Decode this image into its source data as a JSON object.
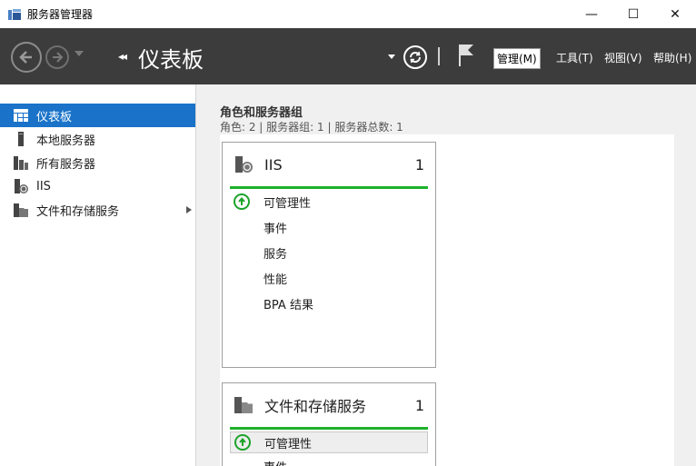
{
  "window": {
    "title": "服务器管理器",
    "controls": {
      "minimize": "—",
      "maximize": "☐",
      "close": "✕"
    }
  },
  "header": {
    "breadcrumb_arrows": "◂◂",
    "title": "仪表板",
    "menus": [
      "管理(M)",
      "工具(T)",
      "视图(V)",
      "帮助(H)"
    ],
    "active_menu_index": 0
  },
  "sidebar": {
    "items": [
      {
        "label": "仪表板",
        "icon": "dashboard-icon",
        "selected": true
      },
      {
        "label": "本地服务器",
        "icon": "local-server-icon"
      },
      {
        "label": "所有服务器",
        "icon": "all-servers-icon"
      },
      {
        "label": "IIS",
        "icon": "iis-icon"
      },
      {
        "label": "文件和存储服务",
        "icon": "file-storage-icon",
        "has_submenu": true
      }
    ]
  },
  "main": {
    "section_title": "角色和服务器组",
    "section_subtitle": "角色: 2 | 服务器组: 1 | 服务器总数: 1",
    "tiles": [
      {
        "name": "IIS",
        "count": "1",
        "status_color": "#1db12b",
        "rows": [
          "可管理性",
          "事件",
          "服务",
          "性能",
          "BPA 结果"
        ]
      },
      {
        "name": "文件和存储服务",
        "count": "1",
        "status_color": "#1db12b",
        "rows": [
          "可管理性",
          "事件"
        ]
      }
    ]
  },
  "colors": {
    "header_bg": "#3c3c3c",
    "selection": "#1a73c9",
    "status_ok": "#1db12b"
  }
}
